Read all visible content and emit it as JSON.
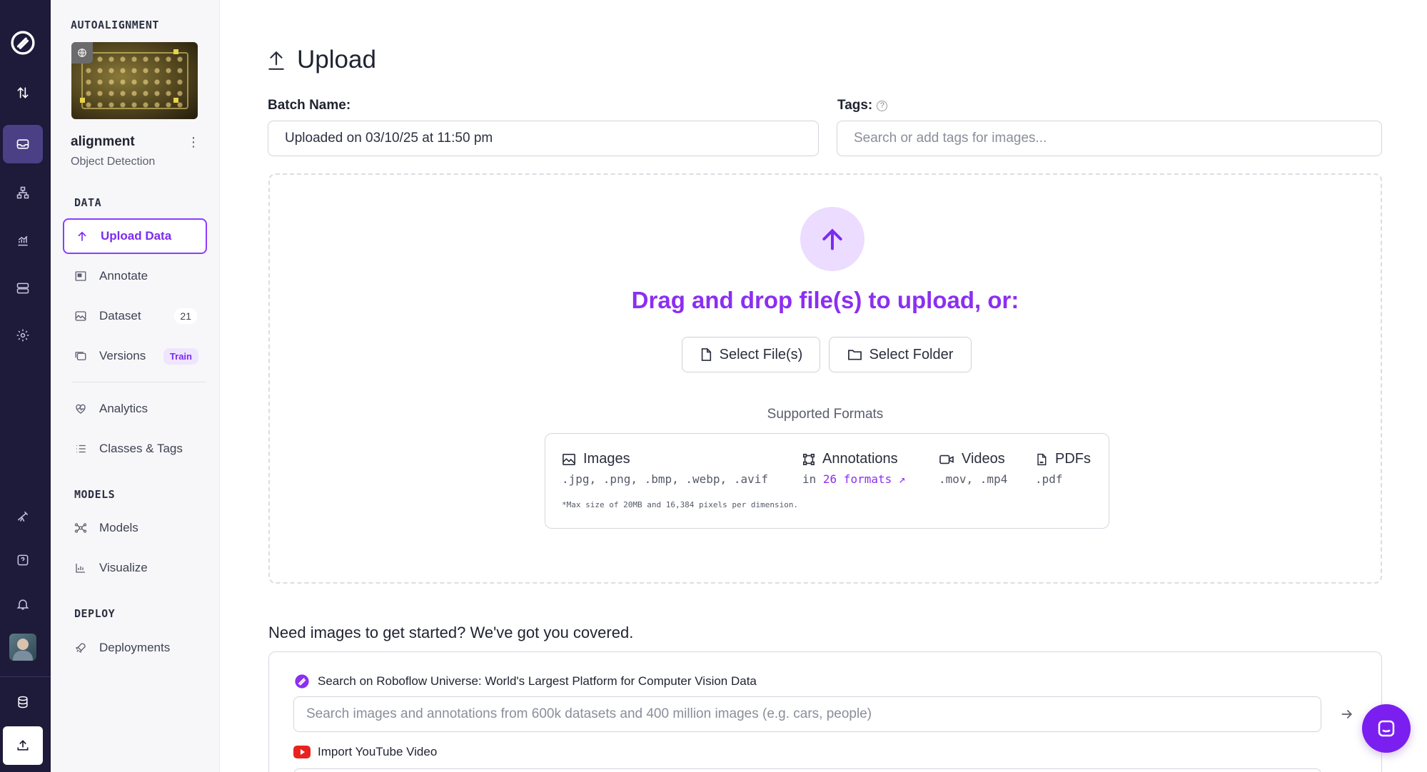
{
  "colors": {
    "accent": "#8b2ff0",
    "rail_bg": "#1d1a3a",
    "rail_active": "#4b4085"
  },
  "rail": {
    "items": [
      {
        "icon": "roboflow-logo-icon"
      },
      {
        "icon": "sort-arrows-icon"
      },
      {
        "icon": "inbox-icon",
        "active": true
      },
      {
        "icon": "workflow-icon"
      },
      {
        "icon": "chart-icon"
      },
      {
        "icon": "server-icon"
      },
      {
        "icon": "gear-icon"
      },
      {
        "icon": "telescope-icon"
      },
      {
        "icon": "help-icon"
      },
      {
        "icon": "bell-icon"
      },
      {
        "icon": "avatar"
      },
      {
        "icon": "database-icon"
      },
      {
        "icon": "upload-icon"
      }
    ]
  },
  "project": {
    "workspace": "AUTOALIGNMENT",
    "name": "alignment",
    "type": "Object Detection"
  },
  "sidebar": {
    "sections": {
      "data": "DATA",
      "models": "MODELS",
      "deploy": "DEPLOY"
    },
    "items": [
      {
        "label": "Upload Data",
        "icon": "upload-arrow-icon",
        "active": true
      },
      {
        "label": "Annotate",
        "icon": "annotate-icon"
      },
      {
        "label": "Dataset",
        "icon": "image-icon",
        "count": "21"
      },
      {
        "label": "Versions",
        "icon": "versions-icon",
        "pill": "Train"
      },
      {
        "label": "Analytics",
        "icon": "heartbeat-icon"
      },
      {
        "label": "Classes & Tags",
        "icon": "list-icon"
      },
      {
        "label": "Models",
        "icon": "model-graph-icon"
      },
      {
        "label": "Visualize",
        "icon": "line-chart-icon"
      },
      {
        "label": "Deployments",
        "icon": "rocket-icon"
      }
    ]
  },
  "main": {
    "title": "Upload",
    "batch_label": "Batch Name:",
    "batch_value": "Uploaded on 03/10/25 at 11:50 pm",
    "tags_label": "Tags:",
    "tags_help": "?",
    "tags_placeholder": "Search or add tags for images...",
    "dropzone": {
      "title": "Drag and drop file(s) to upload, or:",
      "select_files": "Select File(s)",
      "select_folder": "Select Folder",
      "supported_caption": "Supported Formats",
      "formats": {
        "images": {
          "label": "Images",
          "ext": ".jpg, .png, .bmp, .webp, .avif"
        },
        "annotations": {
          "label": "Annotations",
          "prefix": "in",
          "link": "26 formats",
          "link_arrow": "↗"
        },
        "videos": {
          "label": "Videos",
          "ext": ".mov, .mp4"
        },
        "pdfs": {
          "label": "PDFs",
          "ext": ".pdf"
        }
      },
      "note": "*Max size of 20MB and 16,384 pixels per dimension."
    },
    "need_images": "Need images to get started? We've got you covered.",
    "universe": {
      "label": "Search on Roboflow Universe: World's Largest Platform for Computer Vision Data",
      "placeholder": "Search images and annotations from 600k datasets and 400 million images (e.g. cars, people)",
      "youtube_label": "Import YouTube Video"
    }
  }
}
